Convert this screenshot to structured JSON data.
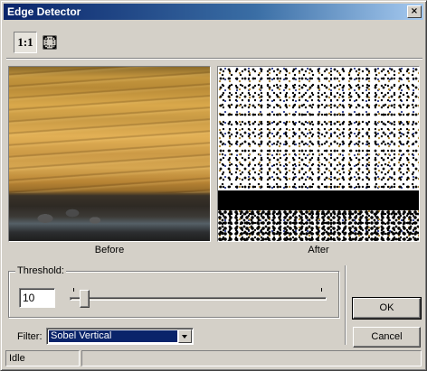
{
  "window": {
    "title": "Edge Detector",
    "close_glyph": "×"
  },
  "toolbar": {
    "actual_size_label": "1:1",
    "fit_icon": "fit-to-window-icon"
  },
  "preview": {
    "before_caption": "Before",
    "after_caption": "After"
  },
  "threshold": {
    "group_label": "Threshold:",
    "value": "10",
    "slider_fraction": 0.04
  },
  "filter": {
    "label": "Filter:",
    "selected": "Sobel Vertical"
  },
  "buttons": {
    "ok": "OK",
    "cancel": "Cancel"
  },
  "status": {
    "text": "Idle",
    "secondary": ""
  },
  "colors": {
    "title_active": "#0a246a",
    "face": "#d4d0c8",
    "selection": "#0a246a"
  }
}
